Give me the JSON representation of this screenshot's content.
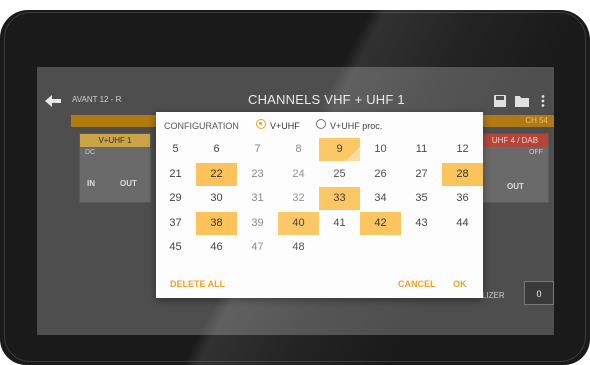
{
  "app": {
    "title": "AVANT 12 - R",
    "banner_right": "CH 54"
  },
  "background": {
    "panel_left_header": "V+UHF 1",
    "panel_left_small": "DC",
    "panel_left_in": "IN",
    "panel_left_out": "OUT",
    "panel_right_header": "UHF 4 / DAB",
    "panel_right_small": "OFF",
    "panel_right_out": "OUT",
    "equalizer_label": "LIZER",
    "equalizer_value": "0"
  },
  "dialog": {
    "title": "CHANNELS  VHF + UHF 1",
    "configuration_label": "CONFIGURATION",
    "options": [
      {
        "label": "V+UHF",
        "selected": true
      },
      {
        "label": "V+UHF proc.",
        "selected": false
      }
    ],
    "delete_all": "DELETE ALL",
    "cancel": "CANCEL",
    "ok": "OK"
  },
  "channels": [
    {
      "n": "5",
      "sel": false
    },
    {
      "n": "6",
      "sel": false
    },
    {
      "n": "7",
      "sel": false,
      "dim": true
    },
    {
      "n": "8",
      "sel": false,
      "dim": true
    },
    {
      "n": "9",
      "sel": true,
      "partial": true
    },
    {
      "n": "10",
      "sel": false
    },
    {
      "n": "11",
      "sel": false
    },
    {
      "n": "12",
      "sel": false
    },
    {
      "n": "21",
      "sel": false
    },
    {
      "n": "22",
      "sel": true
    },
    {
      "n": "23",
      "sel": false,
      "dim": true
    },
    {
      "n": "24",
      "sel": false,
      "dim": true
    },
    {
      "n": "25",
      "sel": false
    },
    {
      "n": "26",
      "sel": false
    },
    {
      "n": "27",
      "sel": false
    },
    {
      "n": "28",
      "sel": true
    },
    {
      "n": "29",
      "sel": false
    },
    {
      "n": "30",
      "sel": false
    },
    {
      "n": "31",
      "sel": false,
      "dim": true
    },
    {
      "n": "32",
      "sel": false,
      "dim": true
    },
    {
      "n": "33",
      "sel": true
    },
    {
      "n": "34",
      "sel": false
    },
    {
      "n": "35",
      "sel": false
    },
    {
      "n": "36",
      "sel": false
    },
    {
      "n": "37",
      "sel": false
    },
    {
      "n": "38",
      "sel": true
    },
    {
      "n": "39",
      "sel": false,
      "dim": true
    },
    {
      "n": "40",
      "sel": true
    },
    {
      "n": "41",
      "sel": false
    },
    {
      "n": "42",
      "sel": true
    },
    {
      "n": "43",
      "sel": false
    },
    {
      "n": "44",
      "sel": false
    },
    {
      "n": "45",
      "sel": false
    },
    {
      "n": "46",
      "sel": false
    },
    {
      "n": "47",
      "sel": false,
      "dim": true
    },
    {
      "n": "48",
      "sel": false
    }
  ],
  "colors": {
    "accent": "#f0a12a",
    "selected_cell": "#fbc35a"
  },
  "icons": [
    "back-arrow-icon",
    "save-icon",
    "folder-icon",
    "more-vert-icon",
    "radio-icon"
  ]
}
